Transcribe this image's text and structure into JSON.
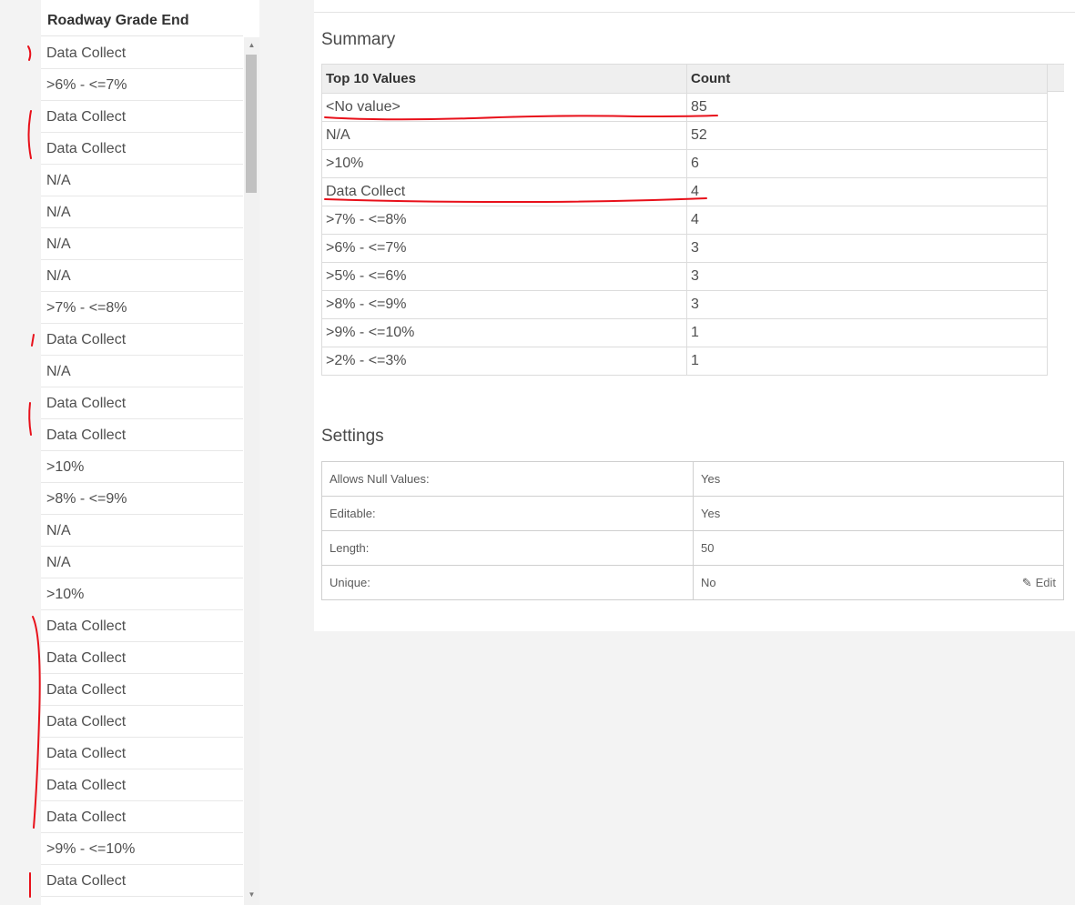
{
  "column": {
    "header": "Roadway Grade End",
    "rows": [
      "Data Collect",
      ">6% - <=7%",
      "Data Collect",
      "Data Collect",
      "N/A",
      "N/A",
      "N/A",
      "N/A",
      ">7% - <=8%",
      "Data Collect",
      "N/A",
      "Data Collect",
      "Data Collect",
      ">10%",
      ">8% - <=9%",
      "N/A",
      "N/A",
      ">10%",
      "Data Collect",
      "Data Collect",
      "Data Collect",
      "Data Collect",
      "Data Collect",
      "Data Collect",
      "Data Collect",
      ">9% - <=10%",
      "Data Collect"
    ],
    "scroll_up": "▲",
    "scroll_down": "▼"
  },
  "summary": {
    "title": "Summary",
    "headers": [
      "Top 10 Values",
      "Count"
    ],
    "rows": [
      [
        "<No value>",
        "85"
      ],
      [
        "N/A",
        "52"
      ],
      [
        ">10%",
        "6"
      ],
      [
        "Data Collect",
        "4"
      ],
      [
        ">7% - <=8%",
        "4"
      ],
      [
        ">6% - <=7%",
        "3"
      ],
      [
        ">5% - <=6%",
        "3"
      ],
      [
        ">8% - <=9%",
        "3"
      ],
      [
        ">9% - <=10%",
        "1"
      ],
      [
        ">2% - <=3%",
        "1"
      ]
    ]
  },
  "settings": {
    "title": "Settings",
    "rows": [
      {
        "label": "Allows Null Values:",
        "value": "Yes"
      },
      {
        "label": "Editable:",
        "value": "Yes"
      },
      {
        "label": "Length:",
        "value": "50"
      },
      {
        "label": "Unique:",
        "value": "No"
      }
    ],
    "edit_label": "Edit",
    "edit_icon": "pencil-icon"
  },
  "colors": {
    "annotation": "#e8101a",
    "header_bg": "#efefef"
  }
}
